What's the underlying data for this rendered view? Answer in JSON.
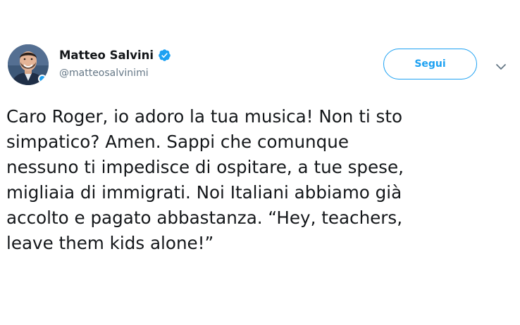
{
  "user": {
    "name": "Matteo Salvini",
    "handle": "@matteosalvinimi",
    "verified": true
  },
  "follow_button": {
    "label": "Segui"
  },
  "tweet": {
    "text_lines": [
      "Caro Roger, io adoro la tua musica! Non ti sto",
      "simpatico? Amen. Sappi che comunque",
      "nessuno ti impedisce di ospitare, a tue spese,",
      "migliaia di immigrati. Noi Italiani abbiamo già",
      "accolto e pagato abbastanza. “Hey, teachers,",
      "leave them kids alone!”"
    ]
  },
  "icons": {
    "verified": "verified-badge-icon",
    "menu": "chevron-down-icon"
  },
  "colors": {
    "accent": "#1da1f2",
    "text": "#14171a",
    "secondary": "#657786"
  }
}
